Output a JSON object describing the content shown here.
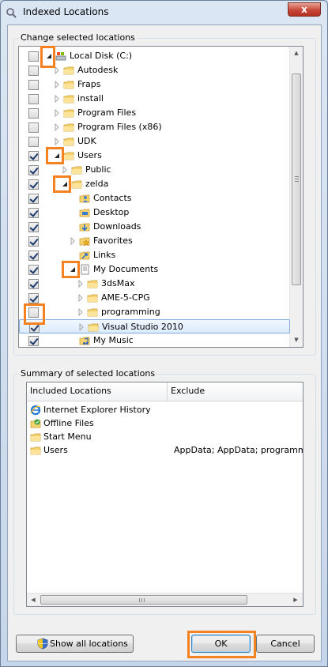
{
  "window": {
    "title": "Indexed Locations",
    "close_glyph": "x",
    "icon": "indexing-icon"
  },
  "locations": {
    "label": "Change selected locations",
    "rows": [
      {
        "label": "Local Disk (C:)",
        "checked": false,
        "expanded": true,
        "icon": "drive-icon"
      },
      {
        "label": "Autodesk",
        "checked": false,
        "expanded": false,
        "icon": "folder-icon"
      },
      {
        "label": "Fraps",
        "checked": false,
        "expanded": false,
        "icon": "folder-icon"
      },
      {
        "label": "install",
        "checked": false,
        "expanded": false,
        "icon": "folder-icon"
      },
      {
        "label": "Program Files",
        "checked": false,
        "expanded": false,
        "icon": "folder-icon"
      },
      {
        "label": "Program Files (x86)",
        "checked": false,
        "expanded": false,
        "icon": "folder-icon"
      },
      {
        "label": "UDK",
        "checked": false,
        "expanded": false,
        "icon": "folder-icon"
      },
      {
        "label": "Users",
        "checked": true,
        "expanded": true,
        "icon": "folder-icon"
      },
      {
        "label": "Public",
        "checked": true,
        "expanded": false,
        "icon": "folder-icon"
      },
      {
        "label": "zelda",
        "checked": true,
        "expanded": true,
        "icon": "folder-icon"
      },
      {
        "label": "Contacts",
        "checked": true,
        "expanded": null,
        "icon": "contacts-icon"
      },
      {
        "label": "Desktop",
        "checked": true,
        "expanded": null,
        "icon": "desktop-icon"
      },
      {
        "label": "Downloads",
        "checked": true,
        "expanded": null,
        "icon": "downloads-icon"
      },
      {
        "label": "Favorites",
        "checked": true,
        "expanded": false,
        "icon": "favorites-icon"
      },
      {
        "label": "Links",
        "checked": true,
        "expanded": null,
        "icon": "links-icon"
      },
      {
        "label": "My Documents",
        "checked": true,
        "expanded": true,
        "icon": "documents-icon"
      },
      {
        "label": "3dsMax",
        "checked": true,
        "expanded": false,
        "icon": "folder-icon"
      },
      {
        "label": "AME-5-CPG",
        "checked": true,
        "expanded": false,
        "icon": "folder-icon"
      },
      {
        "label": "programming",
        "checked": false,
        "expanded": false,
        "icon": "folder-icon"
      },
      {
        "label": "Visual Studio 2010",
        "checked": true,
        "expanded": false,
        "icon": "folder-icon",
        "selected": true
      },
      {
        "label": "My Music",
        "checked": true,
        "expanded": null,
        "icon": "music-icon"
      }
    ]
  },
  "summary": {
    "label": "Summary of selected locations",
    "columns": [
      "Included Locations",
      "Exclude"
    ],
    "rows": [
      {
        "location": "Internet Explorer History",
        "exclude": "",
        "icon": "internet-explorer-icon"
      },
      {
        "location": "Offline Files",
        "exclude": "",
        "icon": "offline-files-icon"
      },
      {
        "location": "Start Menu",
        "exclude": "",
        "icon": "folder-icon"
      },
      {
        "location": "Users",
        "exclude": "AppData; AppData; programming",
        "icon": "folder-icon"
      }
    ]
  },
  "buttons": {
    "show_all": "Show all locations",
    "ok": "OK",
    "cancel": "Cancel"
  },
  "colors": {
    "highlight": "#f58220",
    "selection_border": "#84acdd"
  }
}
